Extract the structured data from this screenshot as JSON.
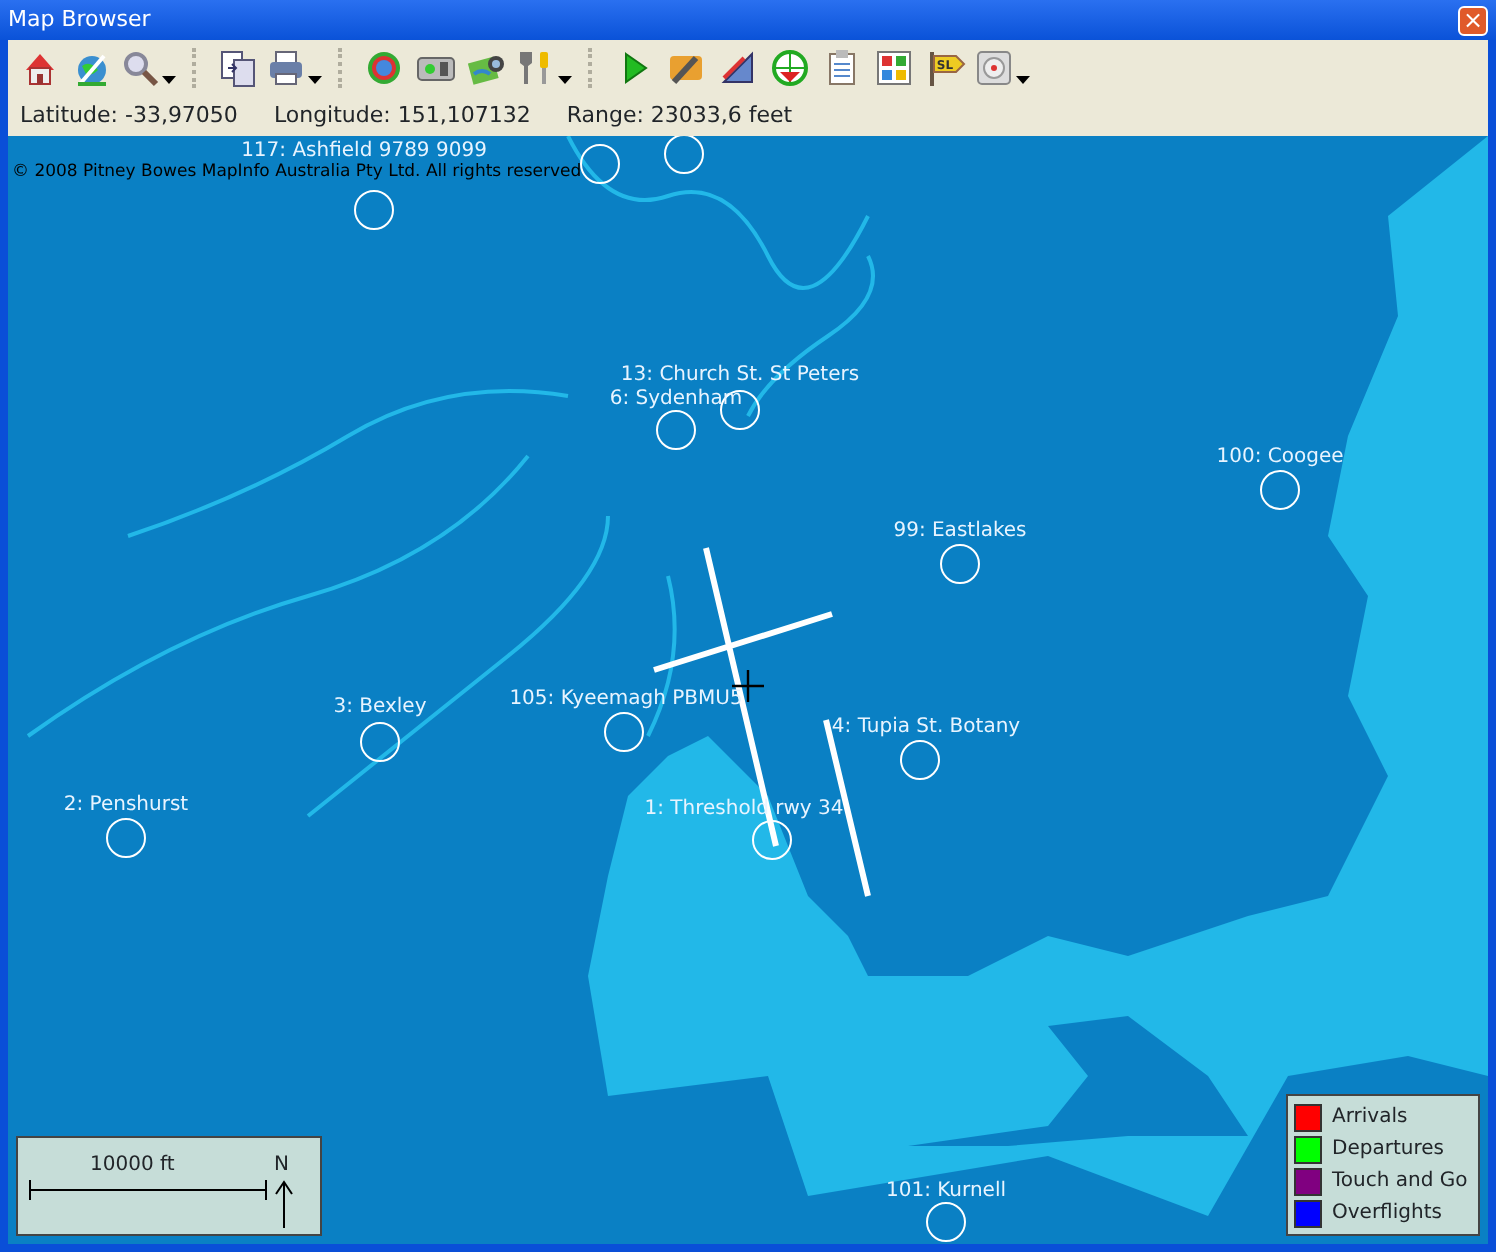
{
  "window": {
    "title": "Map Browser",
    "close": "×"
  },
  "toolbar": {
    "groups": [
      {
        "buttons": [
          {
            "kind": "home",
            "dropdown": false
          },
          {
            "kind": "globe",
            "dropdown": false
          },
          {
            "kind": "zoom",
            "dropdown": true
          }
        ]
      },
      {
        "buttons": [
          {
            "kind": "copy",
            "dropdown": false
          },
          {
            "kind": "print",
            "dropdown": true
          }
        ]
      },
      {
        "buttons": [
          {
            "kind": "ring",
            "dropdown": false
          },
          {
            "kind": "device",
            "dropdown": false
          },
          {
            "kind": "photo",
            "dropdown": false
          },
          {
            "kind": "tools",
            "dropdown": true
          }
        ]
      },
      {
        "buttons": [
          {
            "kind": "play",
            "dropdown": false
          },
          {
            "kind": "edit",
            "dropdown": false
          },
          {
            "kind": "ruler",
            "dropdown": false
          },
          {
            "kind": "target",
            "dropdown": false
          },
          {
            "kind": "clipboard",
            "dropdown": false
          },
          {
            "kind": "grid",
            "dropdown": false
          },
          {
            "kind": "sign",
            "dropdown": false
          },
          {
            "kind": "disc",
            "dropdown": true
          }
        ]
      }
    ],
    "sign_text": "SL"
  },
  "coords": [
    {
      "label": "Latitude:",
      "value": "-33,97050"
    },
    {
      "label": "Longitude:",
      "value": "151,107132"
    },
    {
      "label": "Range:",
      "value": "23033,6 feet"
    }
  ],
  "map": {
    "copyright": "© 2008 Pitney Bowes MapInfo Australia Pty Ltd. All rights reserved",
    "sites": [
      {
        "label": "117: Ashfield  9789  9099"
      },
      {
        "label": "13: Church St. St Peters"
      },
      {
        "label": "6: Sydenham"
      },
      {
        "label": "100: Coogee"
      },
      {
        "label": "99: Eastlakes"
      },
      {
        "label": "3: Bexley"
      },
      {
        "label": "105: Kyeemagh PBMU5"
      },
      {
        "label": "4: Tupia St. Botany"
      },
      {
        "label": "2: Penshurst"
      },
      {
        "label": "1: Threshold rwy 34"
      },
      {
        "label": "101: Kurnell"
      }
    ],
    "scale": {
      "distance": "10000 ft",
      "north": "N"
    },
    "legend": [
      {
        "label": "Arrivals",
        "color": "#ff0000"
      },
      {
        "label": "Departures",
        "color": "#00ff00"
      },
      {
        "label": "Touch and Go",
        "color": "#800080"
      },
      {
        "label": "Overflights",
        "color": "#0000ff"
      }
    ]
  }
}
